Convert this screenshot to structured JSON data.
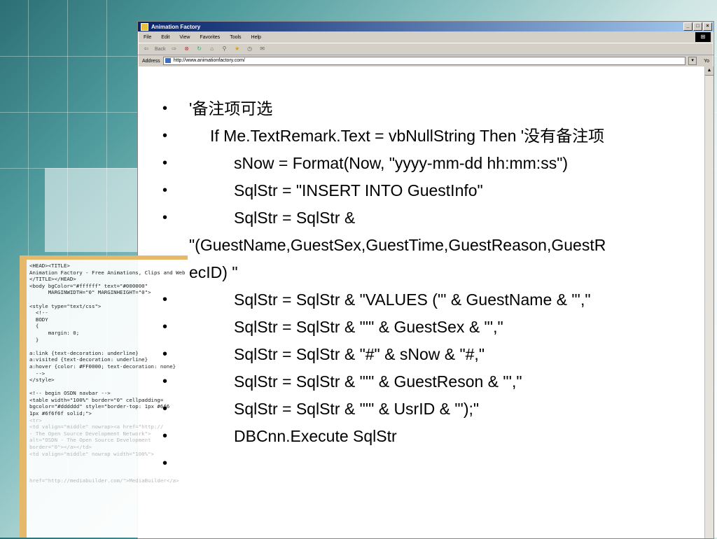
{
  "browser": {
    "title": "Animation Factory",
    "menu": [
      "File",
      "Edit",
      "View",
      "Favorites",
      "Tools",
      "Help"
    ],
    "toolbar_back": "Back",
    "address_label": "Address",
    "address_value": "http://www.animationfactory.com/",
    "go_label": "Yo"
  },
  "code_panel": {
    "lines": [
      "<HEAD><TITLE>",
      "Animation Factory - Free Animations, Clips and Web",
      "</TITLE></HEAD>",
      "<body bgColor=\"#ffffff\" text=\"#000000\"",
      "      MARGINWIDTH=\"0\" MARGINHEIGHT=\"0\">",
      "",
      "<style type=\"text/css\">",
      "  <!--",
      "  BODY",
      "  {",
      "      margin: 0;",
      "  }",
      "",
      "a:link {text-decoration: underline}",
      "a:visited {text-decoration: underline}",
      "a:hover {color: #FF0000; text-decoration: none}",
      "  -->",
      "</style>",
      "",
      "<!-- begin OSDN navbar -->",
      "<table width=\"100%\" border=\"0\" cellpadding=",
      "bgcolor=\"#dddddd\" style=\"border-top: 1px #6f6",
      "1px #6f6f6f solid;\">",
      "<tr>",
      "<td valign=\"middle\" nowrap><a href=\"http://",
      "- The Open Source Development Network\">",
      "alt=\"OSDN - The Open Source Development",
      "border=\"0\"></a></td>",
      "<td valign=\"middle\" nowrap width=\"100%\">",
      "",
      "",
      "",
      "href=\"http://mediabuilder.com/\">MediaBuilder</a>"
    ]
  },
  "slide": {
    "lines": [
      "'备注项可选",
      "If Me.TextRemark.Text = vbNullString Then '没有备注项",
      "sNow = Format(Now, \"yyyy-mm-dd hh:mm:ss\")",
      "SqlStr = \"INSERT INTO GuestInfo\"",
      "SqlStr = SqlStr &",
      "\"(GuestName,GuestSex,GuestTime,GuestReason,GuestR",
      "ecID) \"",
      "SqlStr = SqlStr & \"VALUES ('\" & GuestName & \"',\"",
      "SqlStr = SqlStr & \"'\" & GuestSex & \"',\"",
      "SqlStr = SqlStr & \"#\" & sNow & \"#,\"",
      "SqlStr = SqlStr & \"'\" & GuestReson & \"',\"",
      "SqlStr = SqlStr & \"'\" & UsrID & \"');\"",
      "DBCnn.Execute SqlStr",
      ""
    ]
  }
}
